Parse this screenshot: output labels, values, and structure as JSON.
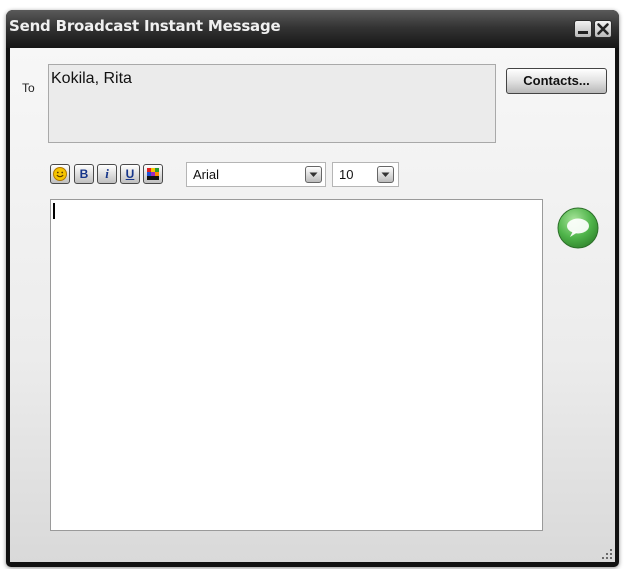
{
  "window": {
    "title": "Send Broadcast Instant Message",
    "minimize_icon": "minimize-icon",
    "close_icon": "close-icon"
  },
  "recipients": {
    "label": "To",
    "value": "Kokila, Rita",
    "contacts_button": "Contacts..."
  },
  "toolbar": {
    "emoticon_icon": "smiley-icon",
    "bold_label": "B",
    "italic_label": "i",
    "underline_label": "U",
    "color_icon": "color-palette-icon",
    "font": {
      "selected": "Arial"
    },
    "size": {
      "selected": "10"
    }
  },
  "message": {
    "value": ""
  },
  "send_icon": "speech-bubble-send-icon",
  "colors": {
    "titlebar": "#161616",
    "send_green": "#3fa83a",
    "emoticon_yellow": "#f5c400",
    "button_text_blue": "#16358a"
  }
}
